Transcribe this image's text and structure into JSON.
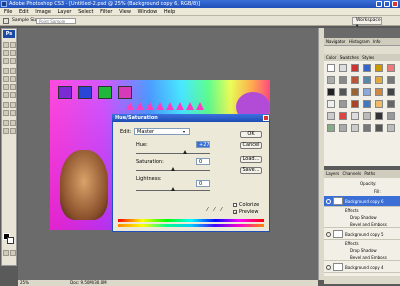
{
  "window": {
    "title": "Adobe Photoshop CS3 - [Untitled-2.psd @ 25% (Background copy 6, RGB/8)]"
  },
  "menu": [
    "File",
    "Edit",
    "Image",
    "Layer",
    "Select",
    "Filter",
    "View",
    "Window",
    "Help"
  ],
  "options": {
    "sample_label": "Sample Size:",
    "sample_value": "Point Sample",
    "workspace_label": "Workspace ▾"
  },
  "toolbox": {
    "logo": "Ps"
  },
  "dialog": {
    "title": "Hue/Saturation",
    "edit_label": "Edit:",
    "edit_value": "Master",
    "hue_label": "Hue:",
    "hue_value": "+27",
    "saturation_label": "Saturation:",
    "saturation_value": "0",
    "lightness_label": "Lightness:",
    "lightness_value": "0",
    "ok_label": "OK",
    "cancel_label": "Cancel",
    "load_label": "Load...",
    "save_label": "Save...",
    "colorize_label": "Colorize",
    "preview_label": "Preview",
    "preview_checked": true,
    "colorize_checked": false
  },
  "panels": {
    "navigator_tabs": [
      "Navigator",
      "Histogram",
      "Info"
    ],
    "color_tabs": [
      "Color",
      "Swatches",
      "Styles"
    ],
    "layers_tabs": [
      "Layers",
      "Channels",
      "Paths"
    ],
    "opacity_label": "Opacity:",
    "fill_label": "Fill:"
  },
  "layers": [
    {
      "name": "Background copy 6",
      "selected": true
    },
    {
      "name": "Effects",
      "sub": true
    },
    {
      "name": "Drop Shadow",
      "sub": true
    },
    {
      "name": "Bevel and Emboss",
      "sub": true
    },
    {
      "name": "Background copy 5",
      "selected": false
    },
    {
      "name": "Effects",
      "sub": true
    },
    {
      "name": "Drop Shadow",
      "sub": true
    },
    {
      "name": "Bevel and Emboss",
      "sub": true
    },
    {
      "name": "Background copy 4",
      "selected": false
    }
  ],
  "status": {
    "zoom": "25%",
    "doc": "Doc: 9.50M/30.0M"
  },
  "colors": {
    "accent": "#1f4fb8",
    "square_colors": [
      "#7a2bd6",
      "#2b46d6",
      "#1fb83a",
      "#d63ab8"
    ]
  }
}
